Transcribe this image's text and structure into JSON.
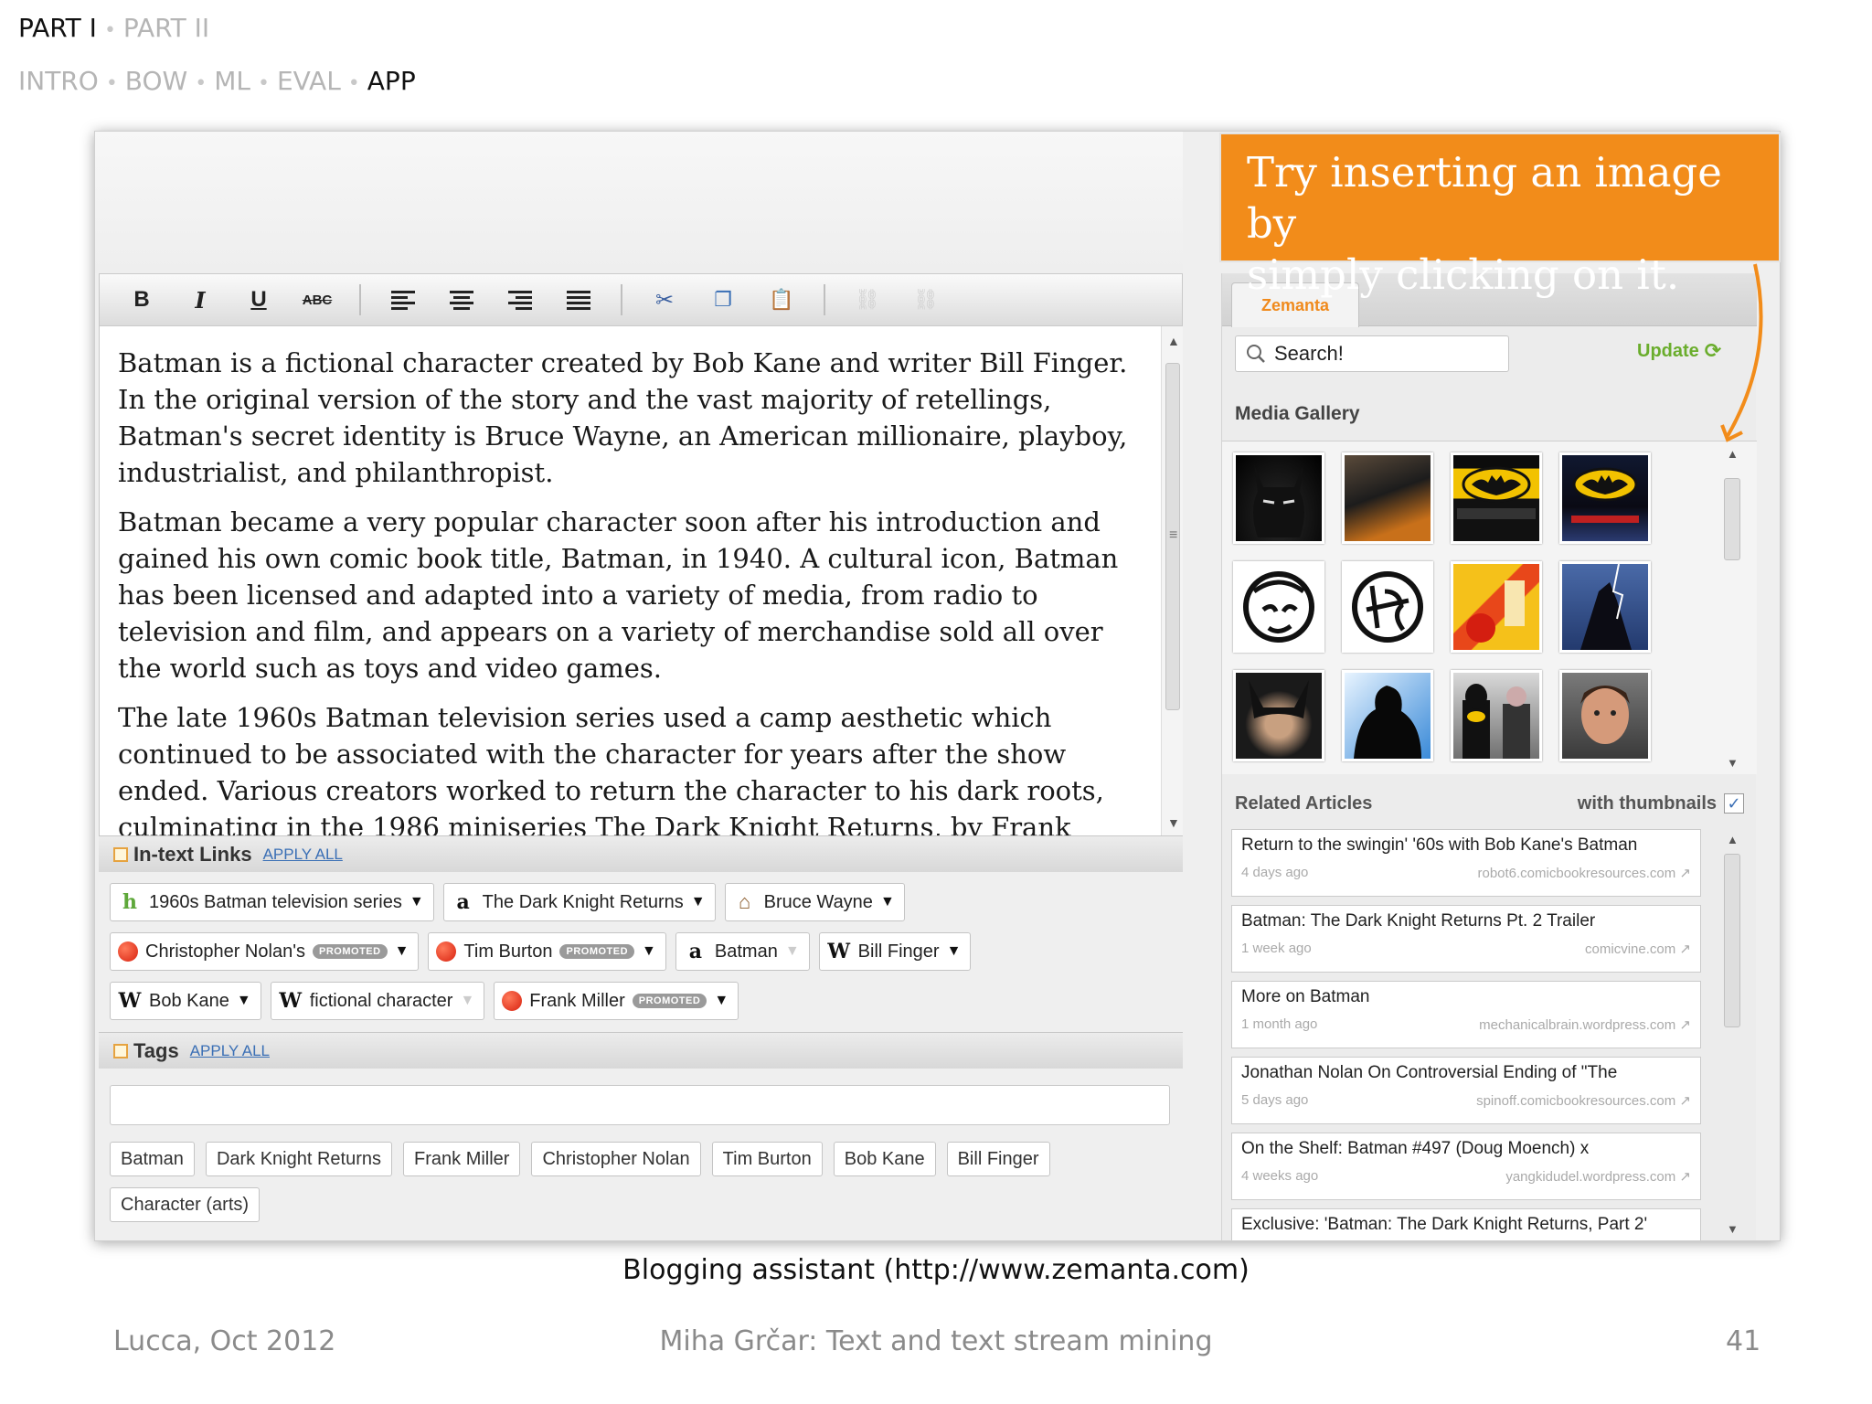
{
  "nav": {
    "parts": [
      "PART I",
      "PART II"
    ],
    "sections": [
      "INTRO",
      "BOW",
      "ML",
      "EVAL",
      "APP"
    ]
  },
  "toolbar": {
    "bold": "B",
    "italic": "I",
    "underline": "U",
    "strike": "ABC"
  },
  "editor": {
    "paragraphs": [
      "Batman is a fictional character created by Bob Kane and writer Bill Finger. In the original version of the story and the vast majority of retellings, Batman's secret identity is Bruce Wayne, an American millionaire, playboy, industrialist, and philanthropist.",
      "Batman became a very popular character soon after his introduction and gained his own comic book title, Batman, in 1940. A cultural icon, Batman has been licensed and adapted into a variety of media, from radio to television and film, and appears on a variety of merchandise sold all over the world such as toys and video games.",
      "The late 1960s Batman television series used a camp aesthetic which continued to be associated with the character for years after the show ended. Various creators worked to return the character to his dark roots, culminating in the 1986 miniseries The Dark Knight Returns, by Frank Miller, while the successes of Tim"
    ]
  },
  "intext_links": {
    "title": "In-text Links",
    "apply_all": "APPLY ALL",
    "promoted_label": "PROMOTED",
    "rows": [
      [
        {
          "label": "1960s Batman television series",
          "icon": "h-icon"
        },
        {
          "label": "The Dark Knight Returns",
          "icon": "amazon-icon"
        },
        {
          "label": "Bruce Wayne",
          "icon": "house-icon"
        }
      ],
      [
        {
          "label": "Christopher Nolan's",
          "icon": "tomato-icon",
          "promoted": true
        },
        {
          "label": "Tim Burton",
          "icon": "tomato-icon",
          "promoted": true
        },
        {
          "label": "Batman",
          "icon": "amazon-icon"
        },
        {
          "label": "Bill Finger",
          "icon": "wikipedia-icon"
        }
      ],
      [
        {
          "label": "Bob Kane",
          "icon": "wikipedia-icon"
        },
        {
          "label": "fictional character",
          "icon": "wikipedia-icon"
        },
        {
          "label": "Frank Miller",
          "icon": "tomato-icon",
          "promoted": true
        }
      ]
    ]
  },
  "tags": {
    "title": "Tags",
    "apply_all": "APPLY ALL",
    "row1": [
      "Batman",
      "Dark Knight Returns",
      "Frank Miller",
      "Christopher Nolan",
      "Tim Burton",
      "Bob Kane",
      "Bill Finger"
    ],
    "row2": [
      "Character (arts)"
    ]
  },
  "sidebar": {
    "tab": "Zemanta",
    "search_placeholder": "Search!",
    "update": "Update",
    "media_gallery": "Media Gallery",
    "related_articles": "Related Articles",
    "with_thumbnails": "with thumbnails",
    "articles": [
      {
        "title": "Return to the swingin' '60s with Bob Kane's Batman",
        "age": "4 days ago",
        "source": "robot6.comicbookresources.com"
      },
      {
        "title": "Batman: The Dark Knight Returns Pt. 2 Trailer",
        "age": "1 week ago",
        "source": "comicvine.com"
      },
      {
        "title": "More on Batman",
        "age": "1 month ago",
        "source": "mechanicalbrain.wordpress.com"
      },
      {
        "title": "Jonathan Nolan On Controversial Ending of \"The",
        "age": "5 days ago",
        "source": "spinoff.comicbookresources.com"
      },
      {
        "title": "On the Shelf: Batman #497 (Doug Moench) x",
        "age": "4 weeks ago",
        "source": "yangkidudel.wordpress.com"
      },
      {
        "title": "Exclusive: 'Batman: The Dark Knight Returns, Part 2'",
        "age": "",
        "source": ""
      }
    ]
  },
  "callout": {
    "line1": "Try inserting an image by",
    "line2": "simply clicking on it."
  },
  "footer": {
    "caption": "Blogging assistant (http://www.zemanta.com)",
    "left": "Lucca, Oct 2012",
    "center": "Miha Grčar: Text and text stream mining",
    "page": "41"
  },
  "colors": {
    "accent": "#f28c1a",
    "update": "#6aad2c",
    "link": "#3a6fb5"
  }
}
